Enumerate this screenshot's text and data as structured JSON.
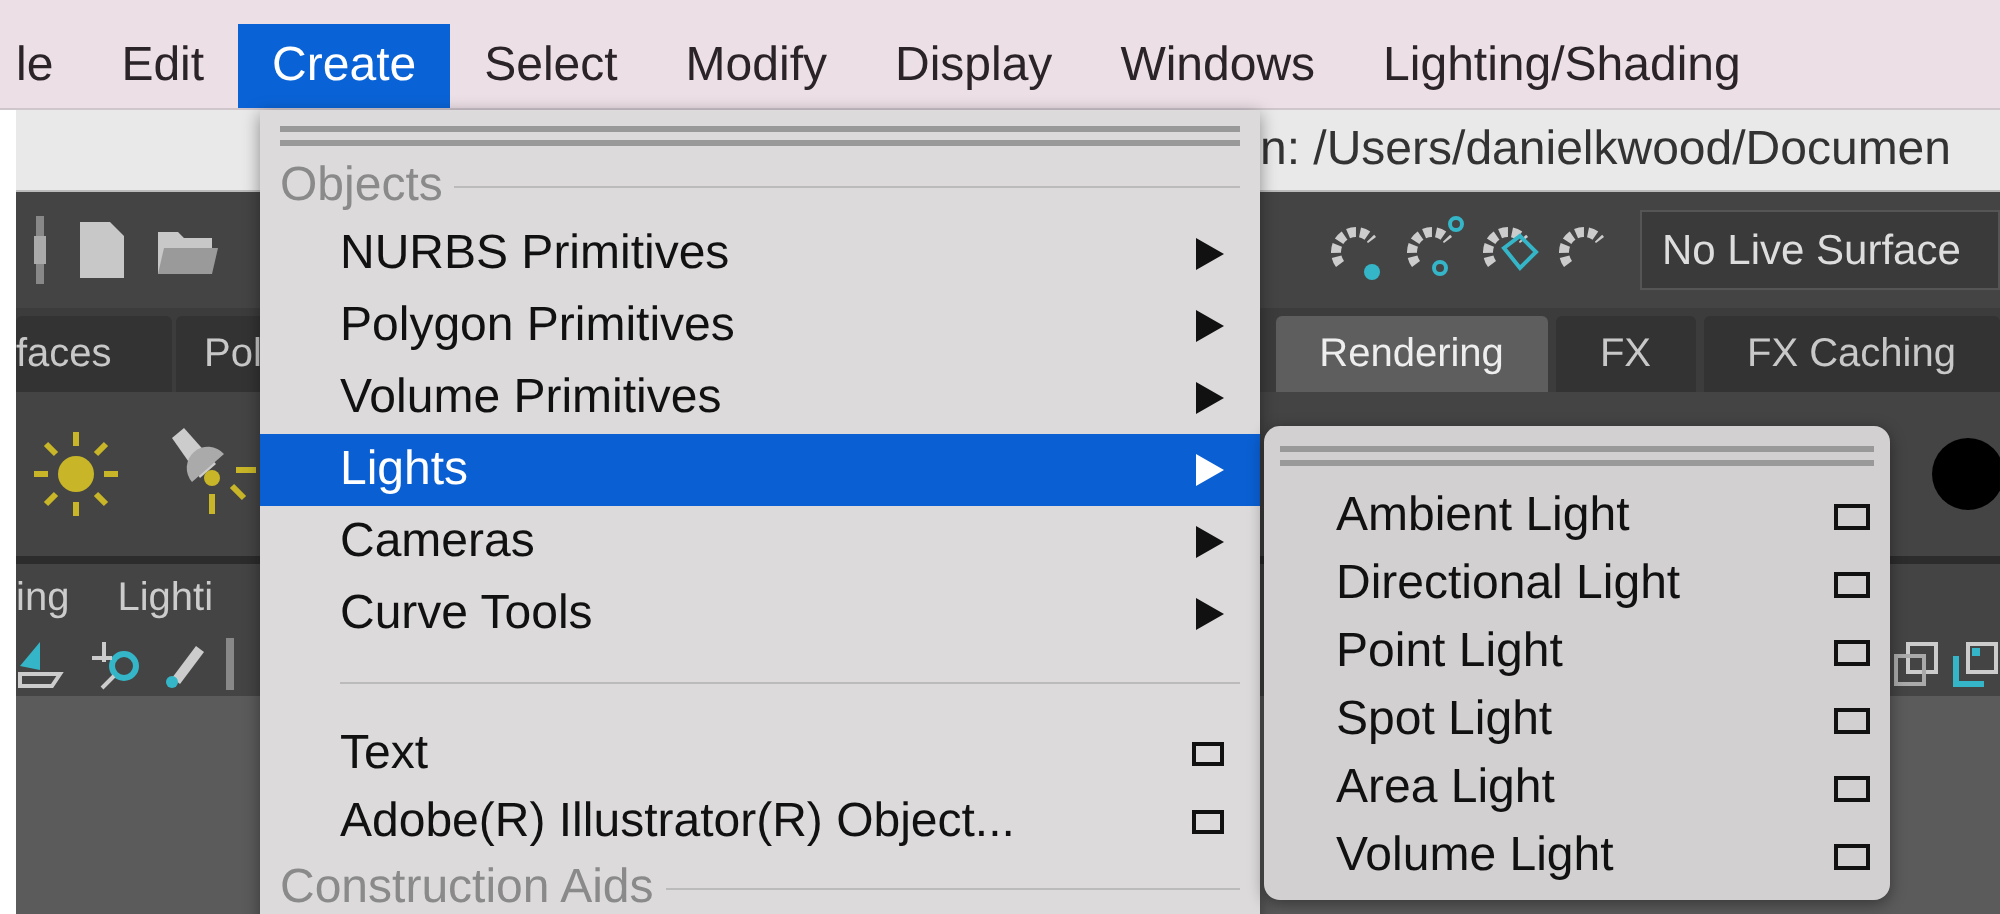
{
  "menubar": [
    {
      "label": "le",
      "selected": false
    },
    {
      "label": "Edit",
      "selected": false
    },
    {
      "label": "Create",
      "selected": true
    },
    {
      "label": "Select",
      "selected": false
    },
    {
      "label": "Modify",
      "selected": false
    },
    {
      "label": "Display",
      "selected": false
    },
    {
      "label": "Windows",
      "selected": false
    },
    {
      "label": "Lighting/Shading",
      "selected": false
    }
  ],
  "path_bar": {
    "text": "n: /Users/danielkwood/Documen"
  },
  "toolbar": {
    "live_surface": "No Live Surface"
  },
  "shelf_tabs": [
    {
      "label": "faces",
      "selected": false
    },
    {
      "label": "Pol",
      "selected": false
    },
    {
      "label": "Rendering",
      "selected": true
    },
    {
      "label": "FX",
      "selected": false
    },
    {
      "label": "FX Caching",
      "selected": false
    }
  ],
  "panel_menus": [
    "ing",
    "Lighti"
  ],
  "create_menu": {
    "items": [
      {
        "kind": "section",
        "label": "Objects"
      },
      {
        "kind": "submenu",
        "label": "NURBS Primitives",
        "selected": false
      },
      {
        "kind": "submenu",
        "label": "Polygon Primitives",
        "selected": false
      },
      {
        "kind": "submenu",
        "label": "Volume Primitives",
        "selected": false
      },
      {
        "kind": "submenu",
        "label": "Lights",
        "selected": true
      },
      {
        "kind": "submenu",
        "label": "Cameras",
        "selected": false
      },
      {
        "kind": "submenu",
        "label": "Curve Tools",
        "selected": false
      },
      {
        "kind": "divider"
      },
      {
        "kind": "option",
        "label": "Text",
        "selected": false
      },
      {
        "kind": "option",
        "label": "Adobe(R) Illustrator(R) Object...",
        "selected": false
      },
      {
        "kind": "section",
        "label": "Construction Aids"
      }
    ]
  },
  "lights_menu": {
    "items": [
      {
        "label": "Ambient Light",
        "selected": false
      },
      {
        "label": "Directional Light",
        "selected": false
      },
      {
        "label": "Point Light",
        "selected": false
      },
      {
        "label": "Spot Light",
        "selected": false
      },
      {
        "label": "Area Light",
        "selected": false
      },
      {
        "label": "Volume Light",
        "selected": false
      }
    ]
  }
}
